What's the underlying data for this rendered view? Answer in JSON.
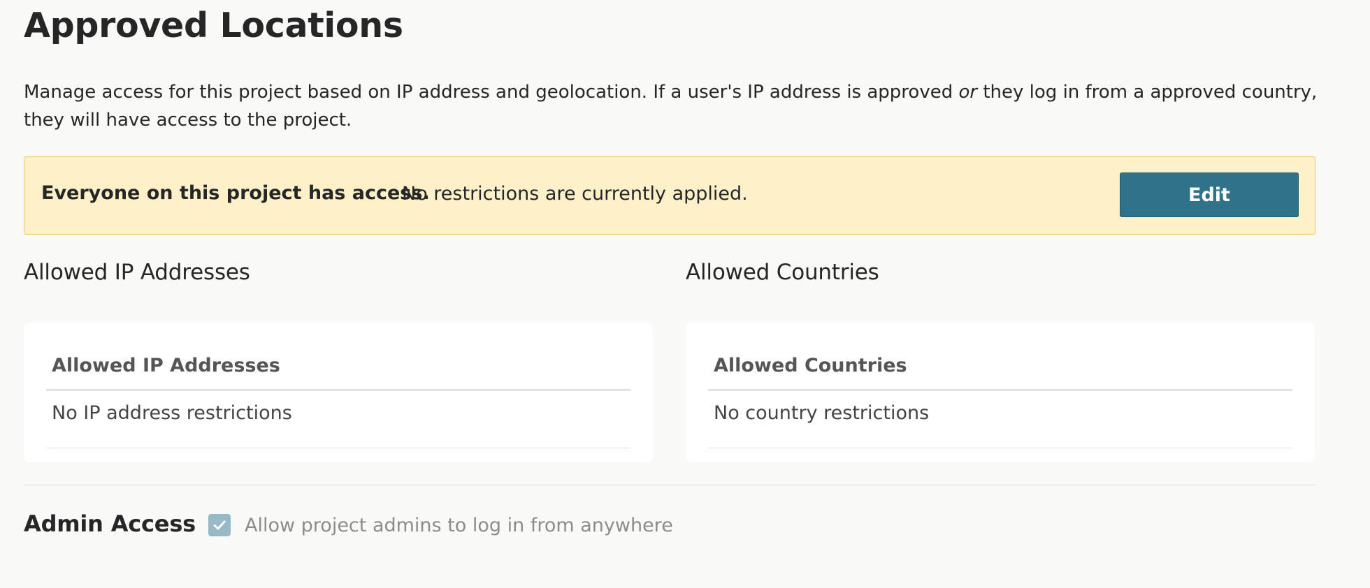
{
  "page": {
    "title": "Approved Locations",
    "description_part1": "Manage access for this project based on IP address and geolocation. If a user's IP address is approved ",
    "description_emphasis": "or",
    "description_part2": " they log in from a approved country, they will have access to the project."
  },
  "banner": {
    "strong_text": "Everyone on this project has access.",
    "text": "No restrictions are currently applied.",
    "edit_label": "Edit",
    "background_color": "#fef1c9",
    "border_color": "#ecc95a"
  },
  "ip_section": {
    "heading": "Allowed IP Addresses",
    "table_header": "Allowed IP Addresses",
    "empty_row": "No IP address restrictions"
  },
  "countries_section": {
    "heading": "Allowed Countries",
    "table_header": "Allowed Countries",
    "empty_row": "No country restrictions"
  },
  "admin_access": {
    "label": "Admin Access",
    "checkbox_label": "Allow project admins to log in from anywhere",
    "checked": true,
    "disabled": true,
    "checkbox_icon": "checkmark-icon"
  },
  "colors": {
    "accent": "#2f7289",
    "checkbox_disabled": "#98b9c6"
  }
}
